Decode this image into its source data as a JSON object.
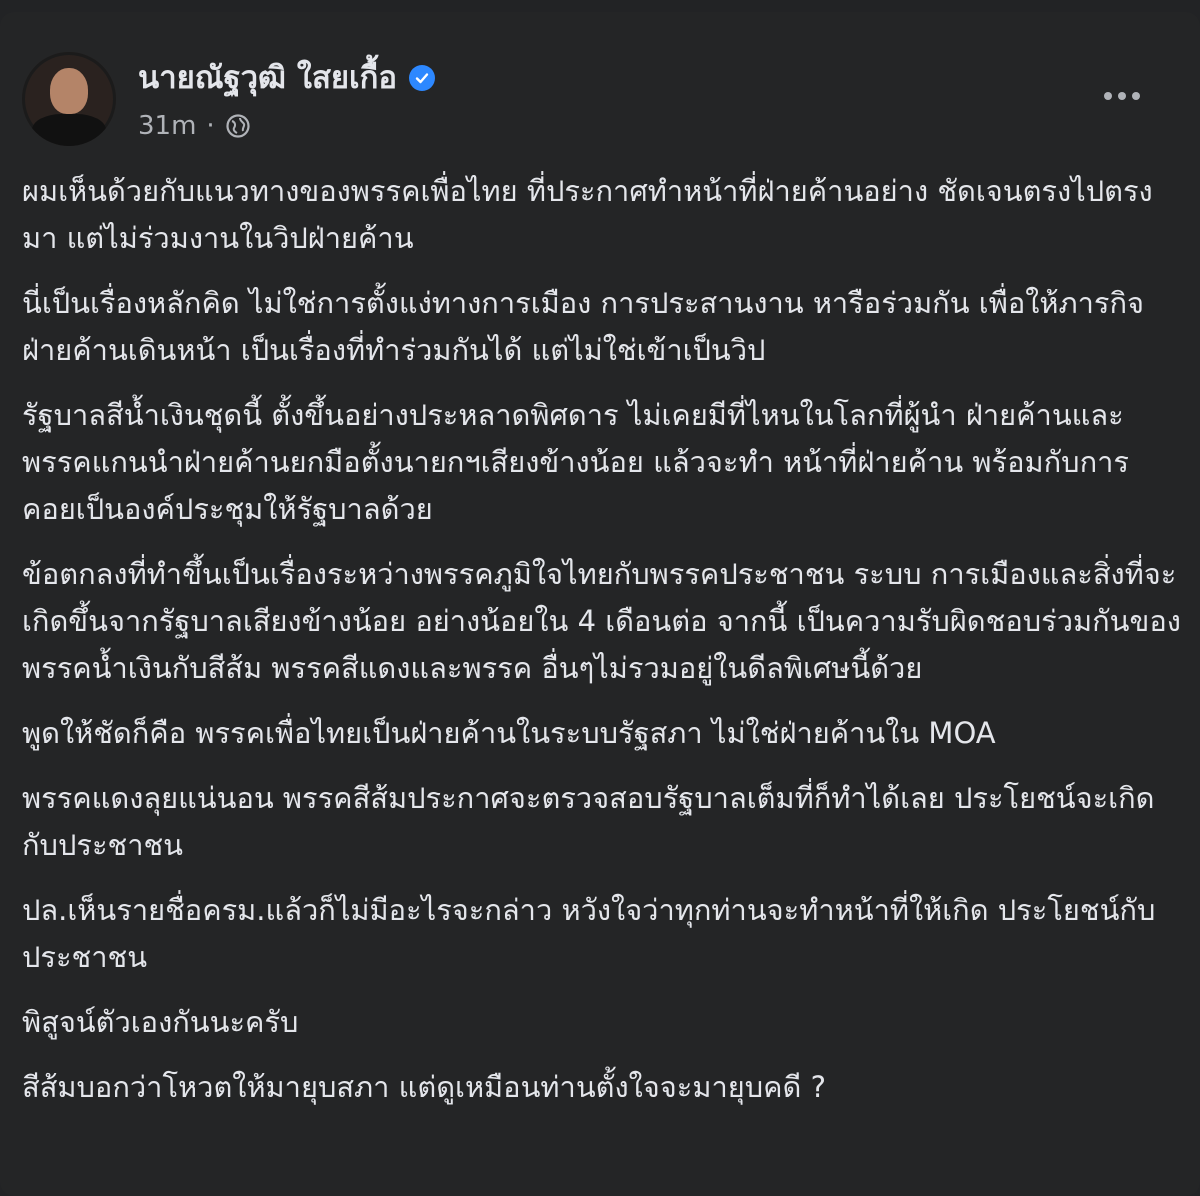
{
  "post": {
    "author_name": "นายณัฐวุฒิ ใสยเกื้อ",
    "timestamp": "31m",
    "separator": "·",
    "verified_icon": "verified-badge-icon",
    "privacy_icon": "globe-icon",
    "more_icon": "more-options-icon",
    "colors": {
      "background": "#242526",
      "text": "#e4e6eb",
      "muted": "#b0b3b8",
      "verified": "#2d88ff"
    },
    "paragraphs": [
      "ผมเห็นด้วยกับแนวทางของพรรคเพื่อไทย ที่ประกาศทำหน้าที่ฝ่ายค้านอย่าง ชัดเจนตรงไปตรงมา แต่ไม่ร่วมงานในวิปฝ่ายค้าน",
      "นี่เป็นเรื่องหลักคิด ไม่ใช่การตั้งแง่ทางการเมือง การประสานงาน หารือร่วมกัน เพื่อให้ภารกิจฝ่ายค้านเดินหน้า เป็นเรื่องที่ทำร่วมกันได้ แต่ไม่ใช่เข้าเป็นวิป",
      "รัฐบาลสีน้ำเงินชุดนี้ ตั้งขึ้นอย่างประหลาดพิศดาร ไม่เคยมีที่ไหนในโลกที่ผู้นำ ฝ่ายค้านและพรรคแกนนำฝ่ายค้านยกมือตั้งนายกฯเสียงข้างน้อย แล้วจะทำ หน้าที่ฝ่ายค้าน พร้อมกับการคอยเป็นองค์ประชุมให้รัฐบาลด้วย",
      "ข้อตกลงที่ทำขึ้นเป็นเรื่องระหว่างพรรคภูมิใจไทยกับพรรคประชาชน ระบบ การเมืองและสิ่งที่จะเกิดขึ้นจากรัฐบาลเสียงข้างน้อย อย่างน้อยใน 4 เดือนต่อ จากนี้ เป็นความรับผิดชอบร่วมกันของพรรคน้ำเงินกับสีส้ม พรรคสีแดงและพรรค อื่นๆไม่รวมอยู่ในดีลพิเศษนี้ด้วย",
      "พูดให้ชัดก็คือ พรรคเพื่อไทยเป็นฝ่ายค้านในระบบรัฐสภา ไม่ใช่ฝ่ายค้านใน MOA",
      "พรรคแดงลุยแน่นอน พรรคสีส้มประกาศจะตรวจสอบรัฐบาลเต็มที่ก็ทำได้เลย ประโยชน์จะเกิดกับประชาชน",
      "ปล.เห็นรายชื่อครม.แล้วก็ไม่มีอะไรจะกล่าว หวังใจว่าทุกท่านจะทำหน้าที่ให้เกิด ประโยชน์กับประชาชน",
      "พิสูจน์ตัวเองกันนะครับ",
      "สีส้มบอกว่าโหวตให้มายุบสภา แต่ดูเหมือนท่านตั้งใจจะมายุบคดี ?"
    ]
  }
}
